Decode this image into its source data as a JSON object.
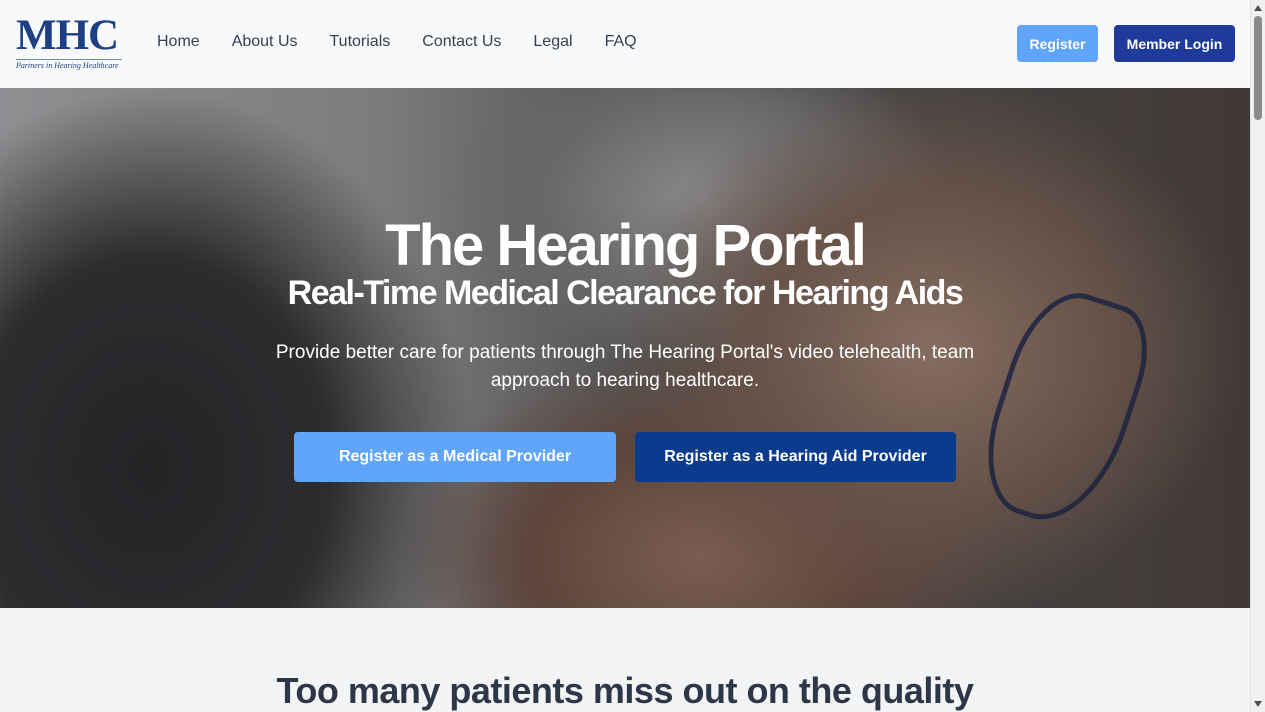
{
  "header": {
    "logo": {
      "mark": "MHC",
      "tagline": "Partners in Hearing Healthcare"
    },
    "nav": [
      {
        "label": "Home"
      },
      {
        "label": "About Us"
      },
      {
        "label": "Tutorials"
      },
      {
        "label": "Contact Us"
      },
      {
        "label": "Legal"
      },
      {
        "label": "FAQ"
      }
    ],
    "register_label": "Register",
    "login_label": "Member Login"
  },
  "hero": {
    "title": "The Hearing Portal",
    "subtitle": "Real-Time Medical Clearance for Hearing Aids",
    "description": "Provide better care for patients through The Hearing Portal's video telehealth, team approach to hearing healthcare.",
    "cta_medical": "Register as a Medical Provider",
    "cta_aid": "Register as a Hearing Aid Provider"
  },
  "section": {
    "heading": "Too many patients miss out on the quality"
  },
  "colors": {
    "brand_navy": "#1e3a9a",
    "accent_blue": "#60a5fa",
    "dark_blue": "#0b3b8c"
  }
}
